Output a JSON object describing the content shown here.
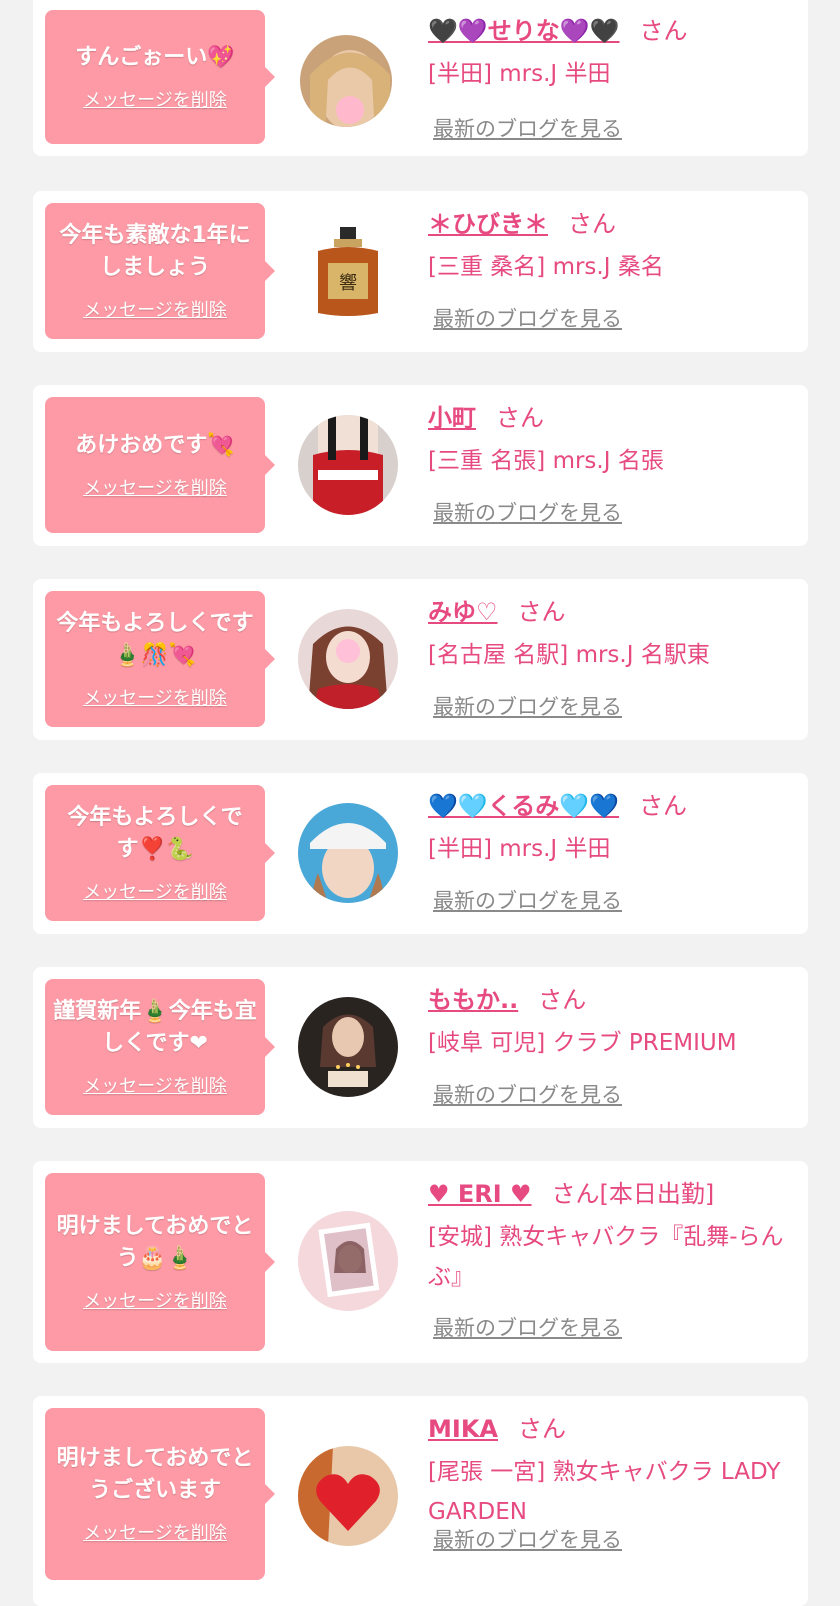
{
  "messages": [
    {
      "message": "すんごぉーい💖",
      "delete_label": "メッセージを削除",
      "name": "🖤💜せりな💜🖤",
      "suffix": "さん",
      "shop": "[半田] mrs.J 半田",
      "blog_label": "最新のブログを見る",
      "avatar": "woman-portrait-blonde"
    },
    {
      "message": "今年も素敵な1年にしましょう",
      "delete_label": "メッセージを削除",
      "name": "＊ひびき＊",
      "suffix": "さん",
      "shop": "[三重 桑名] mrs.J 桑名",
      "blog_label": "最新のブログを見る",
      "avatar": "whisky-bottle"
    },
    {
      "message": "あけおめです💘",
      "delete_label": "メッセージを削除",
      "name": "小町",
      "suffix": "さん",
      "shop": "[三重 名張] mrs.J 名張",
      "blog_label": "最新のブログを見る",
      "avatar": "woman-santa-outfit"
    },
    {
      "message": "今年もよろしくです🎍🎊💘",
      "delete_label": "メッセージを削除",
      "name": "みゆ♡",
      "suffix": "さん",
      "shop": "[名古屋 名駅] mrs.J 名駅東",
      "blog_label": "最新のブログを見る",
      "avatar": "woman-portrait-pink"
    },
    {
      "message": "今年もよろしくです❣️🐍",
      "delete_label": "メッセージを削除",
      "name": "💙🩵くるみ🩵💙",
      "suffix": "さん",
      "shop": "[半田] mrs.J 半田",
      "blog_label": "最新のブログを見る",
      "avatar": "woman-with-cap"
    },
    {
      "message": "謹賀新年🎍今年も宜しくです❤",
      "delete_label": "メッセージを削除",
      "name": "ももか..",
      "suffix": "さん",
      "shop": "[岐阜 可児] クラブ PREMIUM",
      "blog_label": "最新のブログを見る",
      "avatar": "woman-with-cake"
    },
    {
      "message": "明けましておめでとう🎂🎍",
      "delete_label": "メッセージを削除",
      "name": "♥ ERI ♥",
      "suffix": "さん[本日出勤]",
      "shop": "[安城] 熟女キャバクラ『乱舞-らんぶ』",
      "blog_label": "最新のブログを見る",
      "avatar": "woman-photo-frame"
    },
    {
      "message": "明けましておめでとうございます",
      "delete_label": "メッセージを削除",
      "name": "MIKA",
      "suffix": "さん",
      "shop": "[尾張 一宮] 熟女キャバクラ LADY GARDEN",
      "blog_label": "最新のブログを見る",
      "avatar": "heart-covered-face"
    }
  ]
}
